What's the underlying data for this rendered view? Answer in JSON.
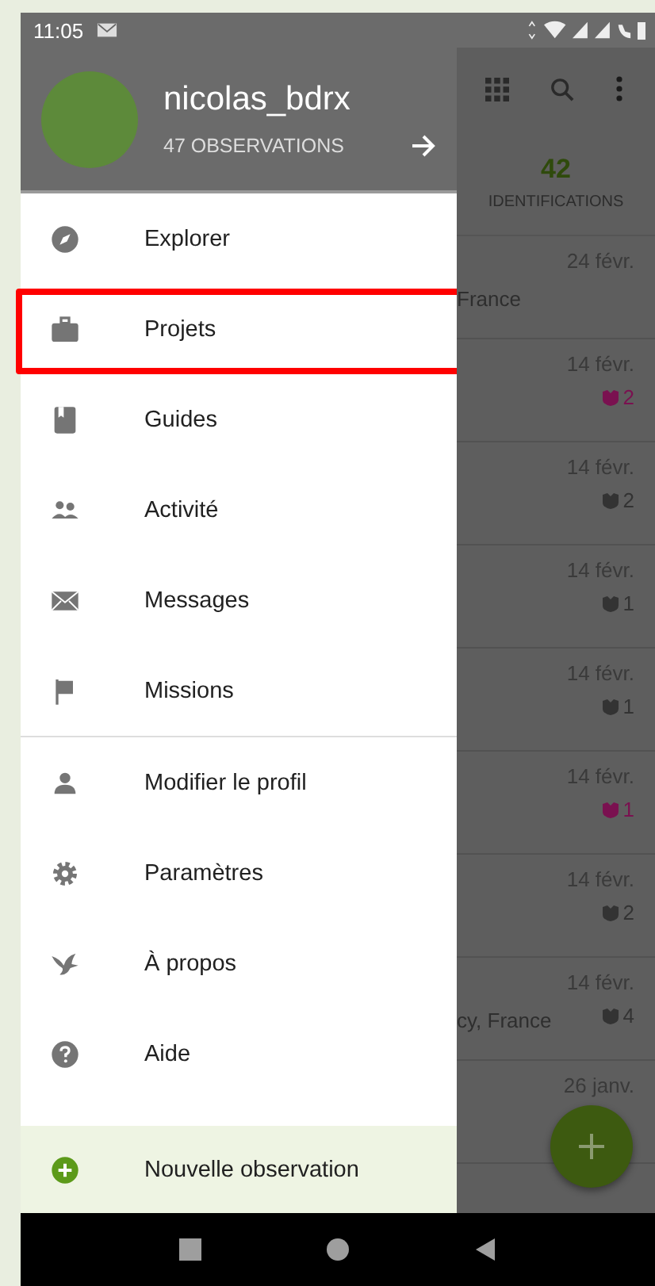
{
  "status_bar": {
    "time": "11:05"
  },
  "drawer": {
    "username": "nicolas_bdrx",
    "observations": "47 OBSERVATIONS",
    "items": [
      {
        "kind": "compass",
        "label": "Explorer",
        "highlighted": false
      },
      {
        "kind": "briefcase",
        "label": "Projets",
        "highlighted": true
      },
      {
        "kind": "book",
        "label": "Guides",
        "highlighted": false
      },
      {
        "kind": "people",
        "label": "Activité",
        "highlighted": false
      },
      {
        "kind": "mail",
        "label": "Messages",
        "highlighted": false
      },
      {
        "kind": "flag",
        "label": "Missions",
        "highlighted": false
      }
    ],
    "secondary_items": [
      {
        "kind": "person",
        "label": "Modifier le profil"
      },
      {
        "kind": "gear",
        "label": "Paramètres"
      },
      {
        "kind": "bird",
        "label": "À propos"
      },
      {
        "kind": "help",
        "label": "Aide"
      }
    ],
    "action": {
      "label": "Nouvelle observation"
    }
  },
  "background": {
    "count": "42",
    "count_label": "IDENTIFICATIONS",
    "rows": [
      {
        "place": "France",
        "date": "24 févr.",
        "ids": ""
      },
      {
        "place": "",
        "date": "14 févr.",
        "ids": "2",
        "color": "#7a1150"
      },
      {
        "place": "",
        "date": "14 févr.",
        "ids": "2",
        "color": "#333333"
      },
      {
        "place": "",
        "date": "14 févr.",
        "ids": "1",
        "color": "#333333"
      },
      {
        "place": "",
        "date": "14 févr.",
        "ids": "1",
        "color": "#333333"
      },
      {
        "place": "",
        "date": "14 févr.",
        "ids": "1",
        "color": "#7a1150"
      },
      {
        "place": "",
        "date": "14 févr.",
        "ids": "2",
        "color": "#333333"
      },
      {
        "place": "cy, France",
        "date": "14 févr.",
        "ids": "4",
        "color": "#333333"
      },
      {
        "place": "",
        "date": "26 janv.",
        "ids": ""
      }
    ]
  }
}
